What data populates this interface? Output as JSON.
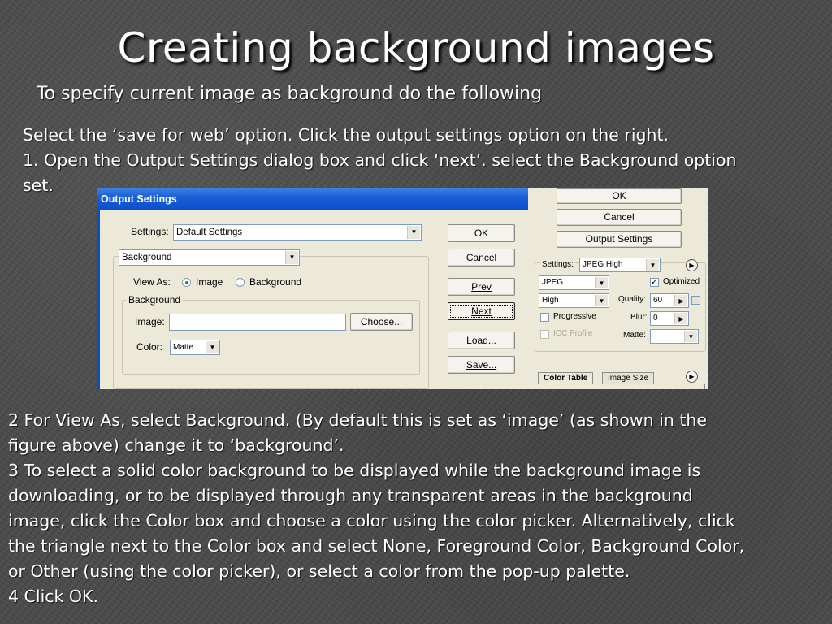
{
  "slide": {
    "title": "Creating background images",
    "subtitle": "To specify current image as background do the following",
    "intro_lines": [
      "Select the ‘save for web’ option. Click the output settings option on the right.",
      "1. Open the Output Settings dialog box and click ‘next’. select the Background option",
      "set."
    ],
    "body_lines": [
      "2 For View As, select Background. (By default this is set as ‘image’ (as shown in the",
      "figure above) change it to ‘background’.",
      "3 To select a solid color background to be displayed while the background image is",
      "downloading, or to be displayed through any transparent areas in the background",
      "image, click the Color box and choose a color using the color picker. Alternatively, click",
      "the triangle next to the Color box and select None, Foreground Color, Background Color,",
      "or Other (using the color picker), or select a color from the pop-up palette.",
      "4 Click OK."
    ]
  },
  "dialog": {
    "title": "Output Settings",
    "settings_label": "Settings:",
    "settings_value": "Default Settings",
    "section_value": "Background",
    "view_as_label": "View As:",
    "radio_image": "Image",
    "radio_background": "Background",
    "group_label": "Background",
    "image_label": "Image:",
    "choose_button": "Choose...",
    "color_label": "Color:",
    "color_value": "Matte",
    "buttons": {
      "ok": "OK",
      "cancel": "Cancel",
      "prev": "Prev",
      "next": "Next",
      "load": "Load...",
      "save": "Save..."
    }
  },
  "save_for_web_panel": {
    "ok": "OK",
    "cancel": "Cancel",
    "output_settings": "Output Settings",
    "settings_label": "Settings:",
    "settings_value": "JPEG High",
    "format_value": "JPEG",
    "quality_preset": "High",
    "optimized_label": "Optimized",
    "quality_label": "Quality:",
    "quality_value": "60",
    "progressive_label": "Progressive",
    "blur_label": "Blur:",
    "blur_value": "0",
    "icc_label": "ICC Profile",
    "matte_label": "Matte:",
    "tab_color_table": "Color Table",
    "tab_image_size": "Image Size"
  }
}
